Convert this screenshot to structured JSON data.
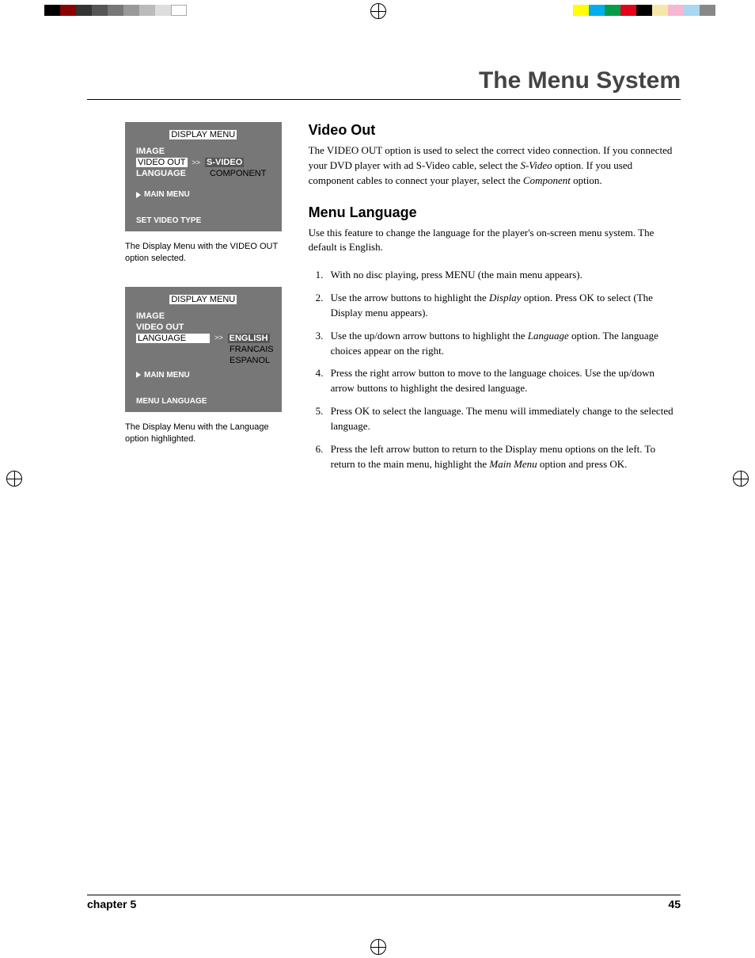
{
  "page_title": "The Menu System",
  "footer": {
    "left": "chapter 5",
    "right": "45"
  },
  "osd1": {
    "title": "DISPLAY MENU",
    "rows": {
      "image": "IMAGE",
      "video_out": "VIDEO OUT",
      "language": "LANGUAGE"
    },
    "options": {
      "svideo": "S-VIDEO",
      "component": "COMPONENT"
    },
    "arrow": ">>",
    "main_menu": "MAIN MENU",
    "foot": "SET VIDEO TYPE"
  },
  "caption1": "The Display Menu with the VIDEO OUT option selected.",
  "osd2": {
    "title": "DISPLAY MENU",
    "rows": {
      "image": "IMAGE",
      "video_out": "VIDEO OUT",
      "language": "LANGUAGE"
    },
    "options": {
      "english": "ENGLISH",
      "francais": "FRANCAIS",
      "espanol": "ESPANOL"
    },
    "arrow": ">>",
    "main_menu": "MAIN MENU",
    "foot": "MENU LANGUAGE"
  },
  "caption2": "The Display Menu with the Language option highlighted.",
  "sec1": {
    "h": "Video Out",
    "p_a": "The VIDEO OUT option is used to select the correct video connection. If you connected your DVD player with ad S-Video cable, select the ",
    "p_b": "S-Video",
    "p_c": " option. If you used component cables to connect your player, select the ",
    "p_d": "Component",
    "p_e": " option."
  },
  "sec2": {
    "h": "Menu Language",
    "intro": "Use this feature to change the language for the player's on-screen menu system. The default is English.",
    "li1": "With no disc playing, press MENU (the main menu appears).",
    "li2_a": "Use the arrow buttons to highlight the ",
    "li2_b": "Display",
    "li2_c": " option. Press OK to select (The Display menu appears).",
    "li3_a": "Use the up/down arrow buttons to highlight the ",
    "li3_b": "Language",
    "li3_c": " option.  The language choices appear on the right.",
    "li4": "Press the right arrow button to move to the language choices. Use the up/down arrow buttons to highlight the desired language.",
    "li5": "Press OK to select the language. The menu will immediately change to the selected language.",
    "li6_a": "Press the left arrow button to return to the Display menu options on the left. To return to the main menu, highlight the ",
    "li6_b": "Main Menu",
    "li6_c": " option and press OK."
  }
}
